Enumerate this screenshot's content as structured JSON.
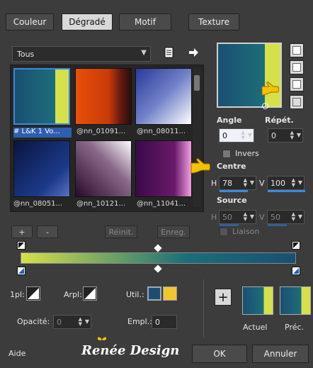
{
  "tabs": [
    {
      "label": "Couleur"
    },
    {
      "label": "Dégradé"
    },
    {
      "label": "Motif"
    },
    {
      "label": "Texture"
    }
  ],
  "preset": {
    "selected": "Tous"
  },
  "gallery": {
    "items": [
      {
        "label": "# L&K 1 Vo..."
      },
      {
        "label": "@nn_01091..."
      },
      {
        "label": "@nn_08011..."
      },
      {
        "label": "@nn_08051..."
      },
      {
        "label": "@nn_10121..."
      },
      {
        "label": "@nn_11041..."
      }
    ]
  },
  "gallery_buttons": {
    "add": "+",
    "remove": "-",
    "reset": "Réinit.",
    "save": "Enreg."
  },
  "angle": {
    "label": "Angle",
    "value": "0"
  },
  "repeat": {
    "label": "Répét.",
    "value": "0"
  },
  "invert": {
    "label": "Invers"
  },
  "center": {
    "label": "Centre",
    "h_label": "H",
    "h_value": "78",
    "v_label": "V",
    "v_value": "100"
  },
  "source": {
    "label": "Source",
    "h_label": "H",
    "h_value": "50",
    "v_label": "V",
    "v_value": "50"
  },
  "link": {
    "label": "Liaison"
  },
  "markers": {
    "first_label": "1pl:",
    "background_label": "Arpl:",
    "user_label": "Util.:",
    "opacity_label": "Opacité:",
    "opacity_value": "0",
    "location_label": "Empl.:",
    "location_value": "0"
  },
  "current": {
    "label": "Actuel"
  },
  "previous": {
    "label": "Préc."
  },
  "watermark": {
    "text": "Renée Design"
  },
  "footer": {
    "help": "Aide",
    "ok": "OK",
    "cancel": "Annuler"
  },
  "colors": {
    "teal_dark": "#1b4f72",
    "teal": "#1c6e7a",
    "lime": "#d6e04a",
    "accent_blue": "#3a8ad8",
    "user_color1": "#1b4f72",
    "user_color2": "#f0c82e"
  }
}
